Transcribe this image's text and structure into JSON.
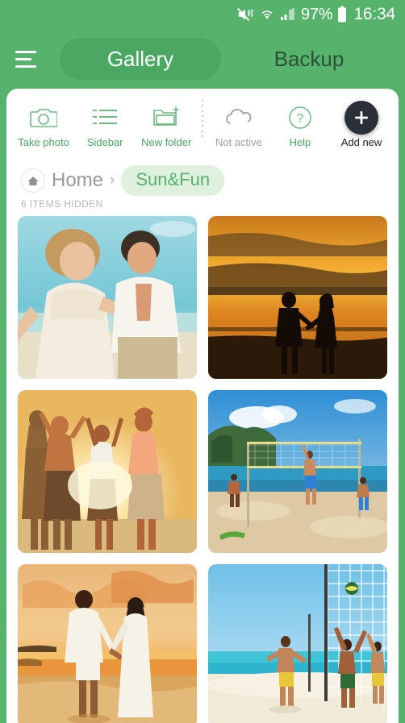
{
  "statusbar": {
    "icons": [
      "mute-vibrate-icon",
      "wifi-icon",
      "signal-icon",
      "battery-icon"
    ],
    "battery_percent": "97%",
    "clock": "16:34"
  },
  "topbar": {
    "menu_icon": "hamburger-icon",
    "tabs": [
      {
        "label": "Gallery",
        "active": true
      },
      {
        "label": "Backup",
        "active": false
      }
    ]
  },
  "toolbar": {
    "items": [
      {
        "label": "Take photo",
        "icon": "camera-icon",
        "state": "active"
      },
      {
        "label": "Sidebar",
        "icon": "list-icon",
        "state": "active"
      },
      {
        "label": "New folder",
        "icon": "new-folder-icon",
        "state": "active"
      },
      {
        "label": "Not active",
        "icon": "cloud-icon",
        "state": "inactive"
      },
      {
        "label": "Help",
        "icon": "question-circle-icon",
        "state": "active"
      },
      {
        "label": "Add new",
        "icon": "plus-icon",
        "state": "fab"
      }
    ]
  },
  "breadcrumb": {
    "home_icon": "home-icon",
    "home_label": "Home",
    "separator": "›",
    "current_folder": "Sun&Fun"
  },
  "content": {
    "hidden_note": "6 ITEMS HIDDEN",
    "photos": [
      {
        "name": "couple-running-on-beach"
      },
      {
        "name": "couple-silhouette-orange-sunset"
      },
      {
        "name": "friends-dancing-at-sunset"
      },
      {
        "name": "beach-volleyball-net-blue-sky"
      },
      {
        "name": "couple-walking-sunset-beach"
      },
      {
        "name": "beach-volleyball-players-net"
      }
    ]
  },
  "colors": {
    "brand_green": "#55b36b",
    "tab_pill": "#4aa862",
    "accent_text": "#4aa862",
    "chip_bg": "#dff0df",
    "inactive_gray": "#9e9e9e",
    "fab_dark": "#2b3038"
  }
}
